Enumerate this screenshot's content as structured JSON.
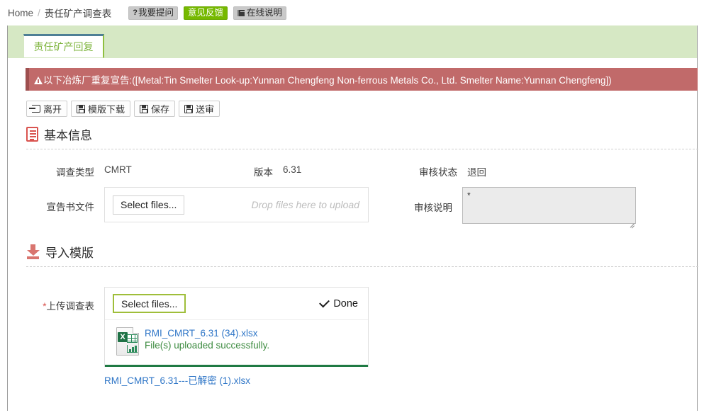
{
  "breadcrumb": {
    "home": "Home",
    "separator": "/",
    "current": "责任矿产调查表"
  },
  "topbar_buttons": [
    {
      "label": "我要提问",
      "icon": "question-mark-icon",
      "style": "gray"
    },
    {
      "label": "意见反馈",
      "icon": "",
      "style": "green"
    },
    {
      "label": "在线说明",
      "icon": "book-icon",
      "style": "gray"
    }
  ],
  "tab": {
    "label": "责任矿产回复"
  },
  "alert": {
    "icon": "warning-triangle-icon",
    "text": "以下冶炼厂重复宣告:([Metal:Tin Smelter Look-up:Yunnan Chengfeng Non-ferrous Metals Co., Ltd. Smelter Name:Yunnan Chengfeng])"
  },
  "toolbar": [
    {
      "label": "离开",
      "icon": "exit-icon"
    },
    {
      "label": "模版下载",
      "icon": "save-icon"
    },
    {
      "label": "保存",
      "icon": "save-icon"
    },
    {
      "label": "送审",
      "icon": "save-icon"
    }
  ],
  "basic_info": {
    "heading": "基本信息",
    "icon": "document-icon",
    "survey_type_label": "调查类型",
    "survey_type_value": "CMRT",
    "version_label": "版本",
    "version_value": "6.31",
    "review_status_label": "审核状态",
    "review_status_value": "退回",
    "declaration_file_label": "宣告书文件",
    "select_files_label": "Select files...",
    "drop_hint": "Drop files here to upload",
    "review_note_label": "审核说明",
    "review_note_value": "*"
  },
  "import_template": {
    "heading": "导入模版",
    "icon": "import-icon",
    "upload_label": "上传调查表",
    "required_mark": "*",
    "select_files_label": "Select files...",
    "done_label": "Done",
    "done_icon": "check-icon",
    "file": {
      "icon": "excel-file-icon",
      "name": "RMI_CMRT_6.31 (34).xlsx",
      "status": "File(s) uploaded successfully.",
      "progress_percent": 100
    },
    "attached_link": "RMI_CMRT_6.31---已解密 (1).xlsx"
  },
  "colors": {
    "tab_strip": "#d6e8c4",
    "tab_text": "#7fb53f",
    "alert_bg": "#c16a6a",
    "feedback_green": "#76b900",
    "link_blue": "#2f76c7",
    "success_green": "#3d8b40",
    "accent_red": "#d9534f"
  }
}
